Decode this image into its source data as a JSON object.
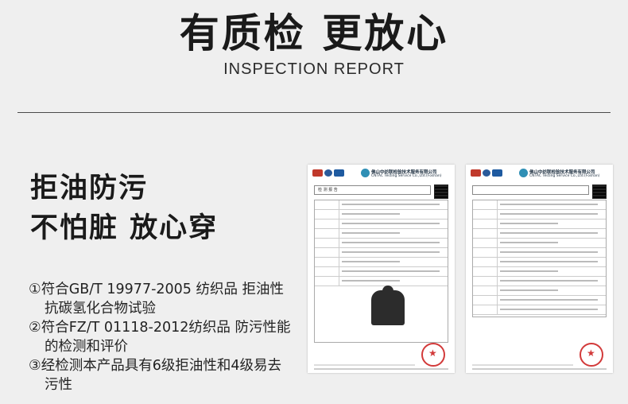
{
  "header": {
    "title": "有质检 更放心",
    "subtitle": "INSPECTION REPORT"
  },
  "slogan": {
    "line1": "拒油防污",
    "line2": "不怕脏 放心穿"
  },
  "items": [
    {
      "line1": "①符合GB/T 19977-2005 纺织品 拒油性",
      "line2": "抗碳氢化合物试验"
    },
    {
      "line1": "②符合FZ/T 01118-2012纺织品    防污性能",
      "line2": "的检测和评价"
    },
    {
      "line1": "③经检测本产品具有6级拒油性和4级易去",
      "line2": "污性"
    }
  ],
  "reports": [
    {
      "company": "佛山中纺联检验技术服务有限公司",
      "company_en": "CNTAC Testing Service Co.,Ltd.(Foshan)",
      "title": "检 测 报 告"
    },
    {
      "company": "佛山中纺联检验技术服务有限公司",
      "company_en": "CNTAC Testing Service Co.,Ltd.(Foshan)",
      "title": ""
    }
  ]
}
